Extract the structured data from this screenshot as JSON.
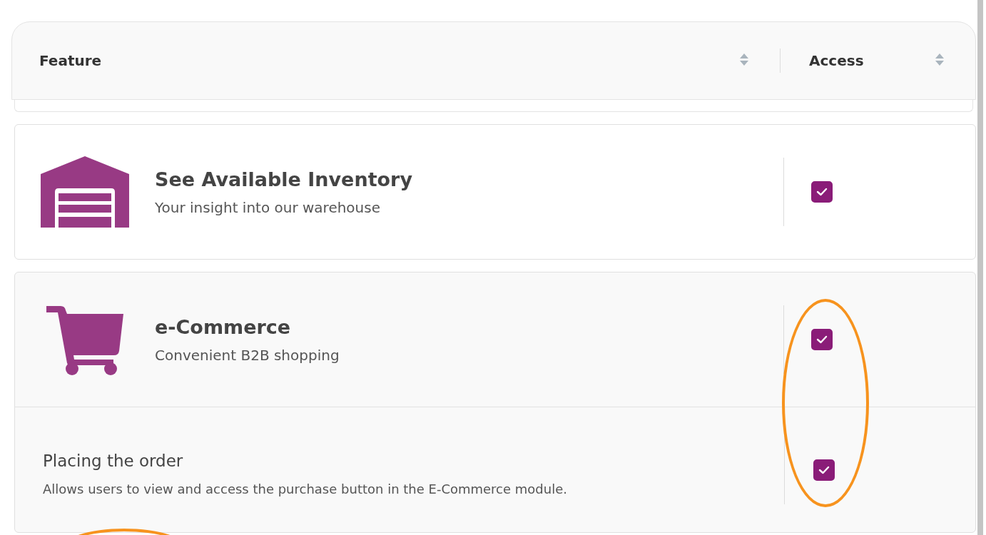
{
  "table": {
    "columns": [
      {
        "label": "Feature"
      },
      {
        "label": "Access"
      }
    ]
  },
  "features": [
    {
      "title": "See Available Inventory",
      "subtitle": "Your insight into our warehouse",
      "checked": true
    },
    {
      "title": "e-Commerce",
      "subtitle": "Convenient B2B shopping",
      "checked": true,
      "permissions": [
        {
          "title": "Placing the order",
          "description": "Allows users to view and access the purchase button in the E-Commerce module.",
          "checked": true
        }
      ]
    }
  ]
}
